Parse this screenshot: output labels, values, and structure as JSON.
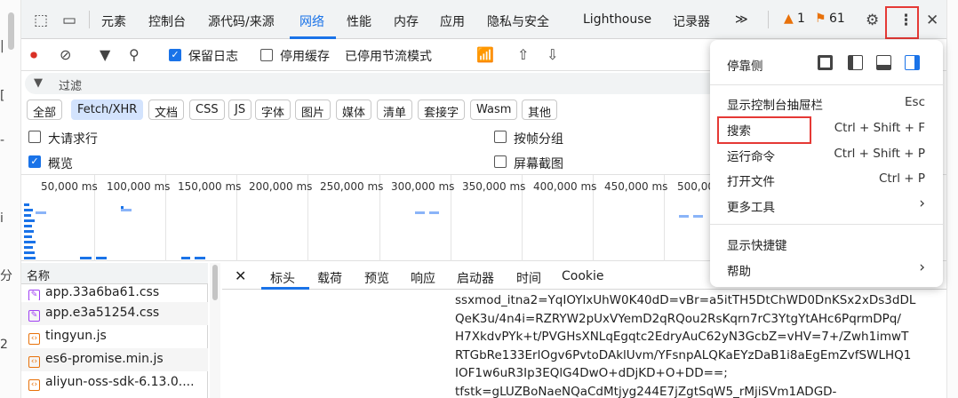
{
  "tabs": [
    "元素",
    "控制台",
    "源代码/来源",
    "网络",
    "性能",
    "内存",
    "应用",
    "隐私与安全",
    "Lighthouse",
    "记录器"
  ],
  "more_tabs": "≫",
  "warnings": "1",
  "issues": "61",
  "toolbar": {
    "preserve_log": "保留日志",
    "disable_cache": "停用缓存",
    "throttle": "已停用节流模式"
  },
  "filter_placeholder": "过滤",
  "type_filters": [
    "全部",
    "Fetch/XHR",
    "文档",
    "CSS",
    "JS",
    "字体",
    "图片",
    "媒体",
    "清单",
    "套接字",
    "Wasm",
    "其他"
  ],
  "options": {
    "big_rows": "大请求行",
    "group_by_frame": "按帧分组",
    "overview": "概览",
    "screenshots": "屏幕截图"
  },
  "timeline_ticks": [
    "50,000 ms",
    "100,000 ms",
    "150,000 ms",
    "200,000 ms",
    "250,000 ms",
    "300,000 ms",
    "350,000 ms",
    "400,000 ms",
    "450,000 ms",
    "500,00"
  ],
  "list": {
    "header": "名称",
    "rows": [
      "app.33a6ba61.css",
      "app.e3a51254.css",
      "tingyun.js",
      "es6-promise.min.js",
      "aliyun-oss-sdk-6.13.0...."
    ]
  },
  "detail_tabs": [
    "标头",
    "载荷",
    "预览",
    "响应",
    "启动器",
    "时间",
    "Cookie"
  ],
  "detail_lines": [
    "ssxmod_itna2=YqIOYlxUhW0K40dD=vBr=a5itTH5DtChWD0DnKSx2xDs3dDL",
    "QeK3u/4n4i=RZRYW2pUxVYemD2qRQou2RsKqrn7rC3YtgYtAHc6PqrmDPq/",
    "H7XkdvPYk+t/PVGHsXNLqEgqtc2EdryAuC62yN3GcbZ=vHV=7+/Zwh1imwT",
    "RTGbRe133ErlOgv6PvtoDAklUvm/YFsnpALQKaEYzDaB1i8aEgEmZvfSWLHQ1",
    "IOF1w6uR3Ip3EQlG4DwO+dDjKD+O+DD==;",
    "tfstk=gLUZBoNaeNQaCdMtjyg244E7jZgtSqW5_rMjiSVm1ADGD-"
  ],
  "menu": {
    "dock_side": "停靠侧",
    "items": [
      {
        "label": "显示控制台抽屉栏",
        "shortcut": "Esc"
      },
      {
        "label": "搜索",
        "shortcut": "Ctrl + Shift + F"
      },
      {
        "label": "运行命令",
        "shortcut": "Ctrl + Shift + P"
      },
      {
        "label": "打开文件",
        "shortcut": "Ctrl + P"
      },
      {
        "label": "更多工具",
        "shortcut": "›"
      }
    ],
    "shortcuts": "显示快捷键",
    "help": "帮助",
    "help_arrow": "›"
  },
  "left_glyphs": [
    "|",
    "[",
    "-",
    "i",
    "分",
    "2"
  ],
  "colors": {
    "accent": "#1a73e8",
    "highlight": "#e53935"
  }
}
